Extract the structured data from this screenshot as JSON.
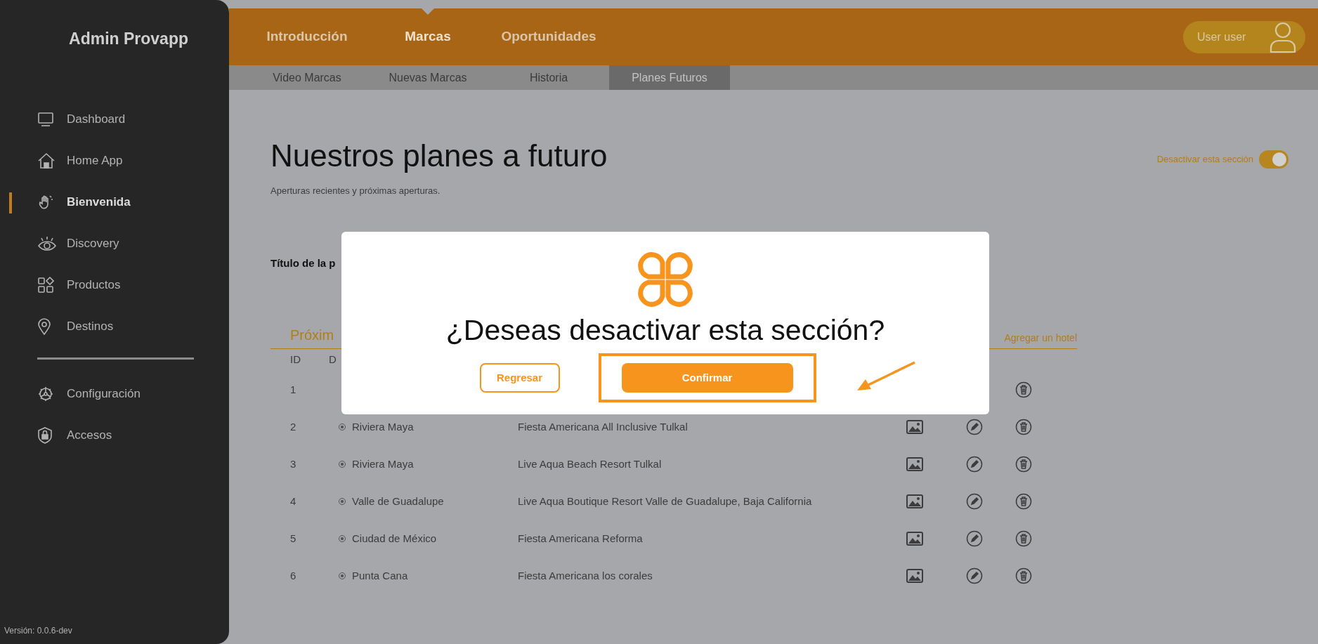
{
  "sidebar": {
    "title": "Admin Provapp",
    "items": [
      {
        "label": "Dashboard",
        "selected": false
      },
      {
        "label": "Home App",
        "selected": false
      },
      {
        "label": "Bienvenida",
        "selected": true
      },
      {
        "label": "Discovery",
        "selected": false
      },
      {
        "label": "Productos",
        "selected": false
      },
      {
        "label": "Destinos",
        "selected": false
      }
    ],
    "bottom_items": [
      {
        "label": "Configuración",
        "selected": false
      },
      {
        "label": "Accesos",
        "selected": false
      }
    ],
    "version": "Versión: 0.0.6-dev"
  },
  "top_nav": {
    "tabs": [
      {
        "label": "Introducción",
        "selected": false
      },
      {
        "label": "Marcas",
        "selected": true
      },
      {
        "label": "Oportunidades",
        "selected": false
      }
    ],
    "user": "User user"
  },
  "sub_nav": {
    "tabs": [
      {
        "label": "Video Marcas",
        "selected": false
      },
      {
        "label": "Nuevas Marcas",
        "selected": false
      },
      {
        "label": "Historia",
        "selected": false
      },
      {
        "label": "Planes Futuros",
        "selected": true
      }
    ]
  },
  "page": {
    "title": "Nuestros planes a futuro",
    "subtitle": "Aperturas recientes y próximas aperturas.",
    "section_toggle": {
      "label": "Desactivar esta sección",
      "on": true
    },
    "field_label": "Título de la p",
    "section_heading": "Próxim",
    "add_link": "Agregar un hotel"
  },
  "table": {
    "columns": [
      "ID",
      "D"
    ],
    "rows": [
      {
        "id": "1"
      },
      {
        "id": "2",
        "destination": "Riviera Maya",
        "hotel": "Fiesta Americana All Inclusive Tulkal"
      },
      {
        "id": "3",
        "destination": "Riviera Maya",
        "hotel": "Live Aqua Beach Resort Tulkal"
      },
      {
        "id": "4",
        "destination": "Valle de Guadalupe",
        "hotel": "Live Aqua Boutique Resort Valle de Guadalupe, Baja California"
      },
      {
        "id": "5",
        "destination": "Ciudad de México",
        "hotel": "Fiesta Americana Reforma"
      },
      {
        "id": "6",
        "destination": "Punta Cana",
        "hotel": "Fiesta Americana los corales"
      }
    ]
  },
  "dialog": {
    "question": "¿Deseas desactivar esta sección?",
    "buttons": [
      {
        "label": "Regresar",
        "kind": "outline",
        "highlighted": false
      },
      {
        "label": "Confirmar",
        "kind": "primary",
        "highlighted": true
      }
    ]
  }
}
